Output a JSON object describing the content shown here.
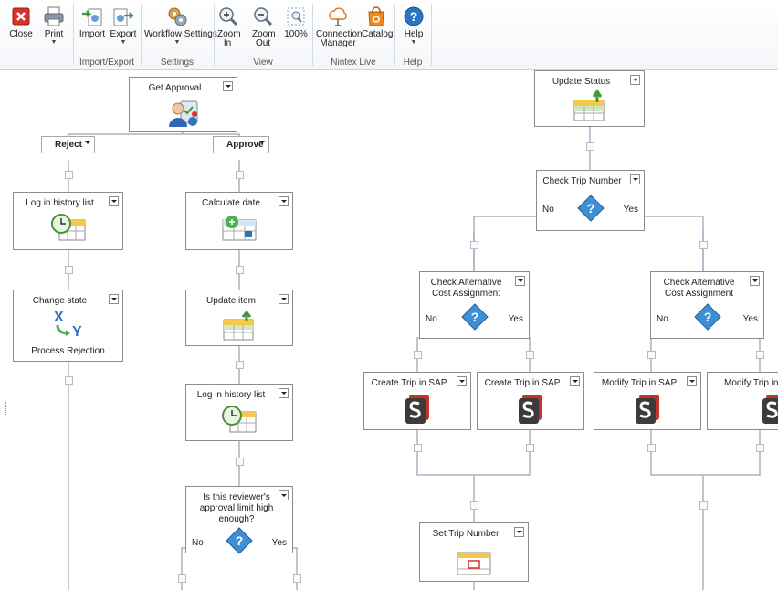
{
  "ribbon": {
    "buttons": {
      "close": "Close",
      "print": "Print",
      "import": "Import",
      "export": "Export",
      "workflow_settings": "Workflow Settings",
      "zoom_in": "Zoom In",
      "zoom_out": "Zoom Out",
      "zoom_100": "100%",
      "connection_manager": "Connection Manager",
      "catalog": "Catalog",
      "help": "Help"
    },
    "groups": {
      "import_export": "Import/Export",
      "settings": "Settings",
      "view": "View",
      "nintex_live": "Nintex Live",
      "help": "Help"
    }
  },
  "workflow": {
    "get_approval": "Get Approval",
    "reject": "Reject",
    "approve": "Approve",
    "log_history_1": "Log in history list",
    "change_state": "Change state",
    "process_rejection": "Process Rejection",
    "calculate_date": "Calculate date",
    "update_item": "Update item",
    "log_history_2": "Log in history list",
    "reviewer_limit": "Is this reviewer's approval limit high enough?",
    "no": "No",
    "yes": "Yes",
    "update_status": "Update Status",
    "check_trip_number": "Check Trip Number",
    "check_alt_cost_1": "Check Alternative Cost Assignment",
    "check_alt_cost_2": "Check Alternative Cost Assignment",
    "create_trip_1": "Create Trip in SAP",
    "create_trip_2": "Create Trip in SAP",
    "modify_trip_1": "Modify Trip in SAP",
    "modify_trip_2": "Modify Trip in SAP",
    "set_trip_number": "Set Trip Number"
  }
}
